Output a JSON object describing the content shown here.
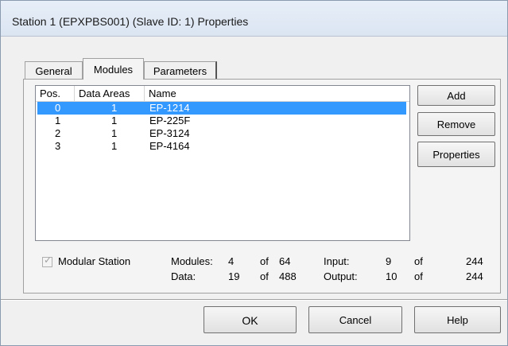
{
  "window": {
    "title": "Station 1 (EPXPBS001) (Slave ID: 1) Properties"
  },
  "tabs": [
    {
      "label": "General"
    },
    {
      "label": "Modules",
      "selected": true
    },
    {
      "label": "Parameters"
    }
  ],
  "list": {
    "columns": [
      "Pos.",
      "Data Areas",
      "Name"
    ],
    "rows": [
      {
        "pos": "0",
        "data_areas": "1",
        "name": "EP-1214",
        "selected": true
      },
      {
        "pos": "1",
        "data_areas": "1",
        "name": "EP-225F"
      },
      {
        "pos": "2",
        "data_areas": "1",
        "name": "EP-3124"
      },
      {
        "pos": "3",
        "data_areas": "1",
        "name": "EP-4164"
      }
    ]
  },
  "side_buttons": {
    "add": "Add",
    "remove": "Remove",
    "properties": "Properties"
  },
  "modular_station": {
    "label": "Modular Station",
    "checked": true,
    "enabled": false
  },
  "stats": {
    "modules_label": "Modules:",
    "modules_value": "4",
    "modules_of": "of",
    "modules_max": "64",
    "data_label": "Data:",
    "data_value": "19",
    "data_of": "of",
    "data_max": "488",
    "input_label": "Input:",
    "input_value": "9",
    "input_of": "of",
    "input_max": "244",
    "output_label": "Output:",
    "output_value": "10",
    "output_of": "of",
    "output_max": "244"
  },
  "dialog_buttons": {
    "ok": "OK",
    "cancel": "Cancel",
    "help": "Help"
  },
  "colors": {
    "selection": "#3399ff",
    "titlebar": "#dbe5f2",
    "dialog_bg": "#f0f0f0"
  }
}
